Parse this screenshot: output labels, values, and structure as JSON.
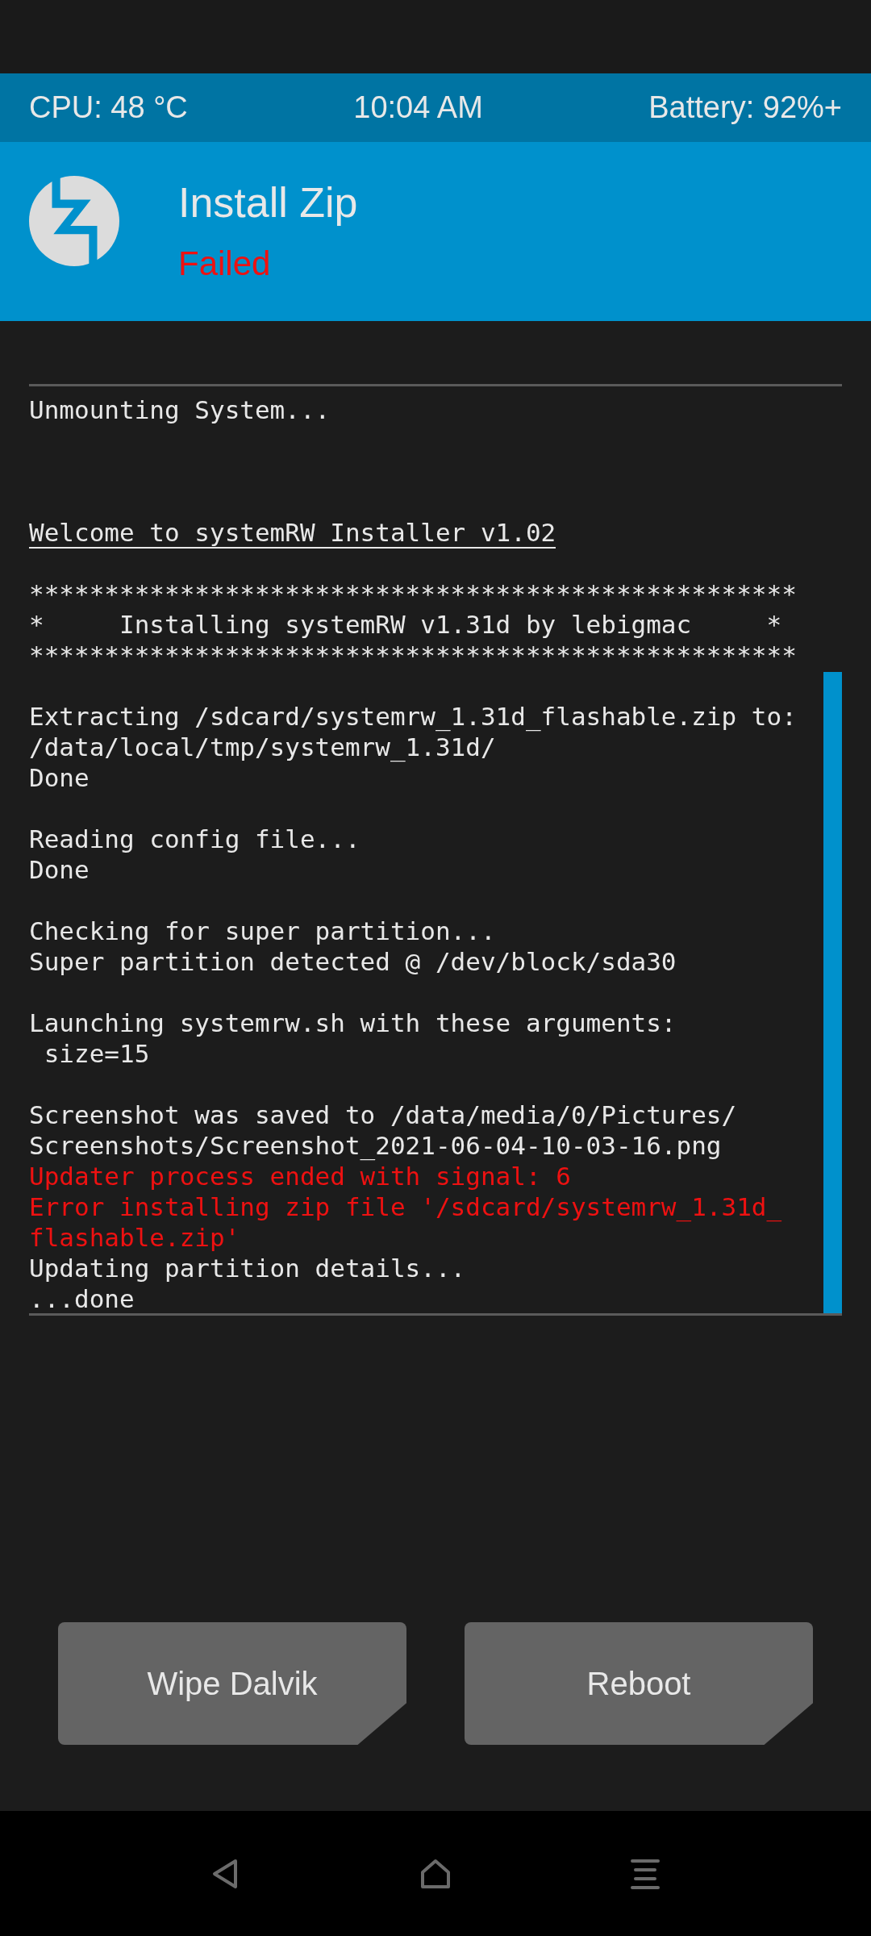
{
  "status_bar": {
    "cpu": "CPU: 48 °C",
    "time": "10:04 AM",
    "battery": "Battery: 92%+"
  },
  "header": {
    "title": "Install Zip",
    "status": "Failed"
  },
  "log": [
    {
      "kind": "normal",
      "text": "Unmounting System..."
    },
    {
      "kind": "gap"
    },
    {
      "kind": "gap"
    },
    {
      "kind": "gap"
    },
    {
      "kind": "heading",
      "text": "Welcome to systemRW Installer v1.02"
    },
    {
      "kind": "gap"
    },
    {
      "kind": "normal",
      "text": "***************************************************"
    },
    {
      "kind": "normal",
      "text": "*     Installing systemRW v1.31d by lebigmac     *"
    },
    {
      "kind": "normal",
      "text": "***************************************************"
    },
    {
      "kind": "gap"
    },
    {
      "kind": "normal",
      "text": "Extracting /sdcard/systemrw_1.31d_flashable.zip to:"
    },
    {
      "kind": "normal",
      "text": "/data/local/tmp/systemrw_1.31d/"
    },
    {
      "kind": "normal",
      "text": "Done"
    },
    {
      "kind": "gap"
    },
    {
      "kind": "normal",
      "text": "Reading config file..."
    },
    {
      "kind": "normal",
      "text": "Done"
    },
    {
      "kind": "gap"
    },
    {
      "kind": "normal",
      "text": "Checking for super partition..."
    },
    {
      "kind": "normal",
      "text": "Super partition detected @ /dev/block/sda30"
    },
    {
      "kind": "gap"
    },
    {
      "kind": "normal",
      "text": "Launching systemrw.sh with these arguments:"
    },
    {
      "kind": "normal",
      "text": " size=15"
    },
    {
      "kind": "gap"
    },
    {
      "kind": "normal",
      "text": "Screenshot was saved to /data/media/0/Pictures/"
    },
    {
      "kind": "normal",
      "text": "Screenshots/Screenshot_2021-06-04-10-03-16.png"
    },
    {
      "kind": "error",
      "text": "Updater process ended with signal: 6"
    },
    {
      "kind": "error",
      "text": "Error installing zip file '/sdcard/systemrw_1.31d_"
    },
    {
      "kind": "error",
      "text": "flashable.zip'"
    },
    {
      "kind": "normal",
      "text": "Updating partition details..."
    },
    {
      "kind": "normal",
      "text": "...done"
    }
  ],
  "buttons": [
    {
      "label": "Wipe Dalvik"
    },
    {
      "label": "Reboot"
    }
  ]
}
